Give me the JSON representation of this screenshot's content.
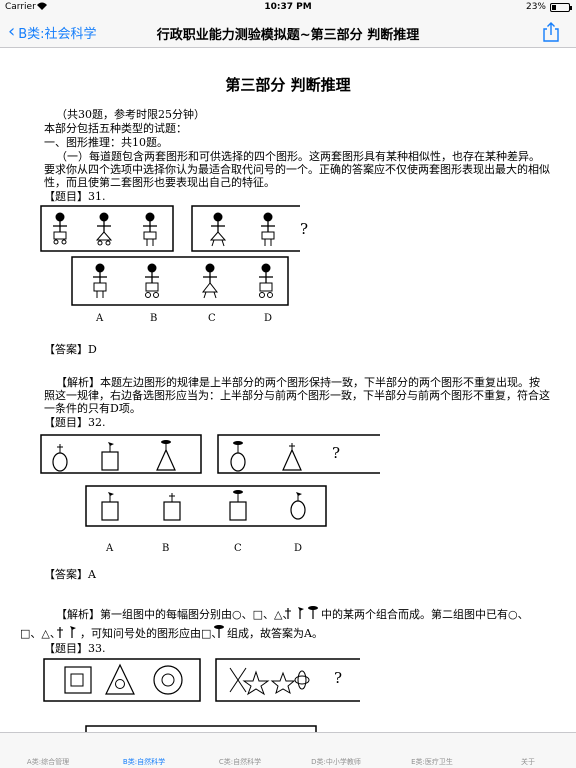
{
  "status": {
    "carrier": "Carrier",
    "time": "10:37 PM",
    "battery": "23%",
    "battery_level": 0.23
  },
  "nav": {
    "back": "B类:社会科学",
    "title": "行政职业能力测验模拟题~第三部分 判断推理"
  },
  "doc": {
    "title": "第三部分  判断推理",
    "intro": [
      "（共30题，参考时限25分钟）",
      "本部分包括五种类型的试题：",
      "一、图形推理：共10题。",
      "（一）每道题包含两套图形和可供选择的四个图形。这两套图形具有某种相似性，也存在某种差异。",
      "要求你从四个选项中选择你认为最适合取代问号的一个。正确的答案应不仅使两套图形表现出最大的相似",
      "性，而且使第二套图形也要表现出自己的特征。"
    ],
    "q31": {
      "label": "【题目】31.",
      "question_mark": "?",
      "options": [
        "A",
        "B",
        "C",
        "D"
      ],
      "answer": "【答案】D",
      "analysis": [
        "【解析】本题左边图形的规律是上半部分的两个图形保持一致，下半部分的两个图形不重复出现。按",
        "照这一规律，右边备选图形应当为：上半部分与前两个图形一致，下半部分与前两个图形不重复，符合这",
        "一条件的只有D项。"
      ]
    },
    "q32": {
      "label": "【题目】32.",
      "question_mark": "?",
      "options": [
        "A",
        "B",
        "C",
        "D"
      ],
      "answer": "【答案】A",
      "analysis_1a": "【解析】第一组图中的每幅图分别由○、□、△、",
      "analysis_1b": "中的某两个组合而成。第二组图中已有○、",
      "analysis_2a": "□、△、",
      "analysis_2b": "，可知问号处的图形应由□、",
      "analysis_2c": "组成，故答案为A。"
    },
    "q33": {
      "label": "【题目】33.",
      "question_mark": "?"
    }
  },
  "tabs": [
    {
      "label": "A类:综合管理",
      "active": false
    },
    {
      "label": "B类:自然科学",
      "active": true
    },
    {
      "label": "C类:自然科学",
      "active": false
    },
    {
      "label": "D类:中小学教师",
      "active": false
    },
    {
      "label": "E类:医疗卫生",
      "active": false
    },
    {
      "label": "关于",
      "active": false
    }
  ],
  "colors": {
    "accent": "#157efb",
    "bar_bg": "#f7f7f7",
    "tab_inactive": "#929292"
  }
}
